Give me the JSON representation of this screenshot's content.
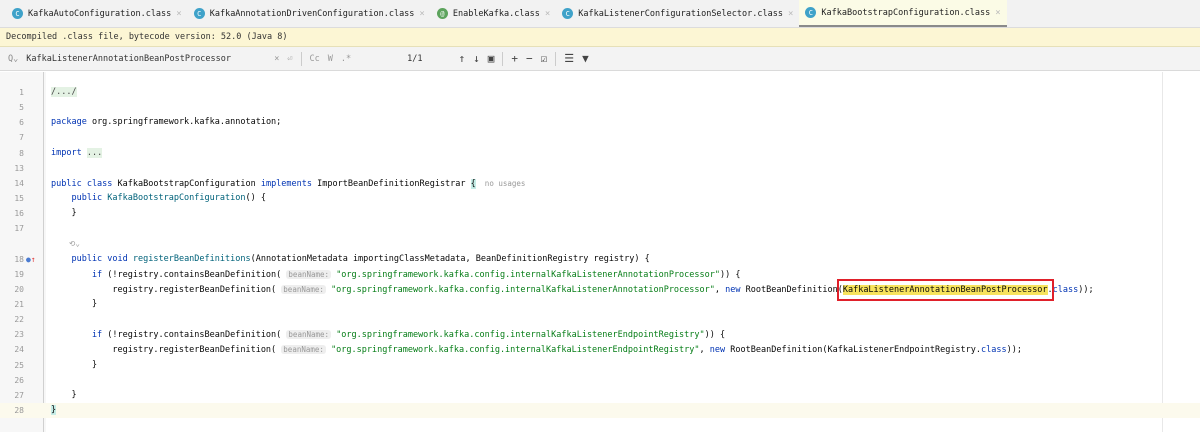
{
  "tabs": [
    {
      "label": "KafkaAutoConfiguration.class",
      "icon": "C",
      "kind": "class",
      "active": false
    },
    {
      "label": "KafkaAnnotationDrivenConfiguration.class",
      "icon": "C",
      "kind": "class",
      "active": false
    },
    {
      "label": "EnableKafka.class",
      "icon": "@",
      "kind": "annotation",
      "active": false
    },
    {
      "label": "KafkaListenerConfigurationSelector.class",
      "icon": "C",
      "kind": "class",
      "active": false
    },
    {
      "label": "KafkaBootstrapConfiguration.class",
      "icon": "C",
      "kind": "class",
      "active": true
    }
  ],
  "banner": "Decompiled .class file, bytecode version: 52.0 (Java 8)",
  "search": {
    "value": "KafkaListenerAnnotationBeanPostProcessor",
    "match_case": "Cc",
    "words": "W",
    "regex": ".*",
    "count": "1/1"
  },
  "lines": [
    {
      "n": "1",
      "tokens": [
        {
          "t": "/.../",
          "c": "fold"
        }
      ]
    },
    {
      "n": "5",
      "tokens": []
    },
    {
      "n": "6",
      "tokens": [
        {
          "t": "package",
          "c": "kw"
        },
        {
          "t": " org.springframework.kafka.annotation;",
          "c": ""
        }
      ]
    },
    {
      "n": "7",
      "tokens": []
    },
    {
      "n": "8",
      "tokens": [
        {
          "t": "import",
          "c": "kw"
        },
        {
          "t": " ",
          "c": ""
        },
        {
          "t": "...",
          "c": "fold"
        }
      ]
    },
    {
      "n": "13",
      "tokens": []
    },
    {
      "n": "14",
      "tokens": [
        {
          "t": "public class ",
          "c": "kw"
        },
        {
          "t": "KafkaBootstrapConfiguration ",
          "c": ""
        },
        {
          "t": "implements ",
          "c": "kw"
        },
        {
          "t": "ImportBeanDefinitionRegistrar ",
          "c": ""
        },
        {
          "t": "{",
          "c": "brace"
        },
        {
          "t": "  no usages",
          "c": "muted"
        }
      ]
    },
    {
      "n": "15",
      "tokens": [
        {
          "t": "    public ",
          "c": "kw"
        },
        {
          "t": "KafkaBootstrapConfiguration",
          "c": "fn"
        },
        {
          "t": "() {",
          "c": ""
        }
      ]
    },
    {
      "n": "16",
      "tokens": [
        {
          "t": "    }",
          "c": ""
        }
      ]
    },
    {
      "n": "17",
      "tokens": []
    },
    {
      "n": "",
      "tokens": [
        {
          "t": "    ⟲⌄",
          "c": "muted"
        }
      ]
    },
    {
      "n": "18",
      "mark": true,
      "tokens": [
        {
          "t": "    public void ",
          "c": "kw"
        },
        {
          "t": "registerBeanDefinitions",
          "c": "fn"
        },
        {
          "t": "(AnnotationMetadata importingClassMetadata, BeanDefinitionRegistry registry) {",
          "c": ""
        }
      ]
    },
    {
      "n": "19",
      "tokens": [
        {
          "t": "        if ",
          "c": "kw"
        },
        {
          "t": "(!registry.containsBeanDefinition( ",
          "c": ""
        },
        {
          "t": "beanName:",
          "c": "hint"
        },
        {
          "t": " ",
          "c": ""
        },
        {
          "t": "\"org.springframework.kafka.config.internalKafkaListenerAnnotationProcessor\"",
          "c": "str"
        },
        {
          "t": ")) {",
          "c": ""
        }
      ]
    },
    {
      "n": "20",
      "tokens": [
        {
          "t": "            registry.registerBeanDefinition( ",
          "c": ""
        },
        {
          "t": "beanName:",
          "c": "hint"
        },
        {
          "t": " ",
          "c": ""
        },
        {
          "t": "\"org.springframework.kafka.config.internalKafkaListenerAnnotationProcessor\"",
          "c": "str"
        },
        {
          "t": ", ",
          "c": ""
        },
        {
          "t": "new ",
          "c": "kw"
        },
        {
          "t": "RootBeanDefinition(",
          "c": ""
        },
        {
          "t": "KafkaListenerAnnotationBeanPostProcessor",
          "c": "hl box"
        },
        {
          "t": ".",
          "c": ""
        },
        {
          "t": "class",
          "c": "kw"
        },
        {
          "t": "));",
          "c": ""
        }
      ]
    },
    {
      "n": "21",
      "tokens": [
        {
          "t": "        }",
          "c": ""
        }
      ]
    },
    {
      "n": "22",
      "tokens": []
    },
    {
      "n": "23",
      "tokens": [
        {
          "t": "        if ",
          "c": "kw"
        },
        {
          "t": "(!registry.containsBeanDefinition( ",
          "c": ""
        },
        {
          "t": "beanName:",
          "c": "hint"
        },
        {
          "t": " ",
          "c": ""
        },
        {
          "t": "\"org.springframework.kafka.config.internalKafkaListenerEndpointRegistry\"",
          "c": "str"
        },
        {
          "t": ")) {",
          "c": ""
        }
      ]
    },
    {
      "n": "24",
      "tokens": [
        {
          "t": "            registry.registerBeanDefinition( ",
          "c": ""
        },
        {
          "t": "beanName:",
          "c": "hint"
        },
        {
          "t": " ",
          "c": ""
        },
        {
          "t": "\"org.springframework.kafka.config.internalKafkaListenerEndpointRegistry\"",
          "c": "str"
        },
        {
          "t": ", ",
          "c": ""
        },
        {
          "t": "new ",
          "c": "kw"
        },
        {
          "t": "RootBeanDefinition(KafkaListenerEndpointRegistry.",
          "c": ""
        },
        {
          "t": "class",
          "c": "kw"
        },
        {
          "t": "));",
          "c": ""
        }
      ]
    },
    {
      "n": "25",
      "tokens": [
        {
          "t": "        }",
          "c": ""
        }
      ]
    },
    {
      "n": "26",
      "tokens": []
    },
    {
      "n": "27",
      "tokens": [
        {
          "t": "    }",
          "c": ""
        }
      ]
    },
    {
      "n": "28",
      "current": true,
      "tokens": [
        {
          "t": "}",
          "c": "brace"
        }
      ]
    }
  ]
}
